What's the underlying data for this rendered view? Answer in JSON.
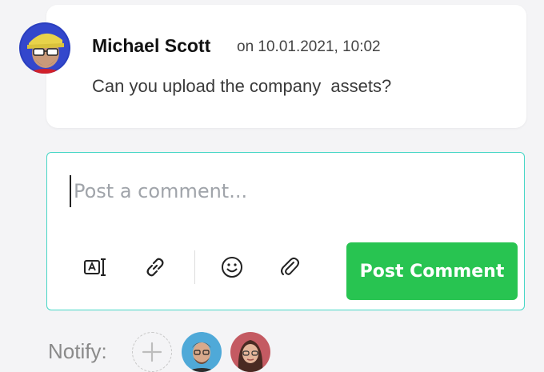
{
  "comment": {
    "author": "Michael Scott",
    "timestamp": "on 10.01.2021, 10:02",
    "text": "Can you upload the company  assets?",
    "avatar_icon": "user-avatar-michael-scott"
  },
  "composer": {
    "placeholder": "Post a comment...",
    "value": "",
    "tools": [
      {
        "icon": "text-format-icon"
      },
      {
        "icon": "link-icon"
      },
      {
        "icon": "emoji-icon"
      },
      {
        "icon": "attachment-icon"
      }
    ],
    "post_label": "Post Comment"
  },
  "notify": {
    "label": "Notify:",
    "add_icon": "plus-icon",
    "users": [
      {
        "name": "notify-user-1"
      },
      {
        "name": "notify-user-2"
      }
    ]
  },
  "colors": {
    "accent_green": "#28c451",
    "composer_border": "#46d6c6",
    "background": "#f4f4f6"
  }
}
